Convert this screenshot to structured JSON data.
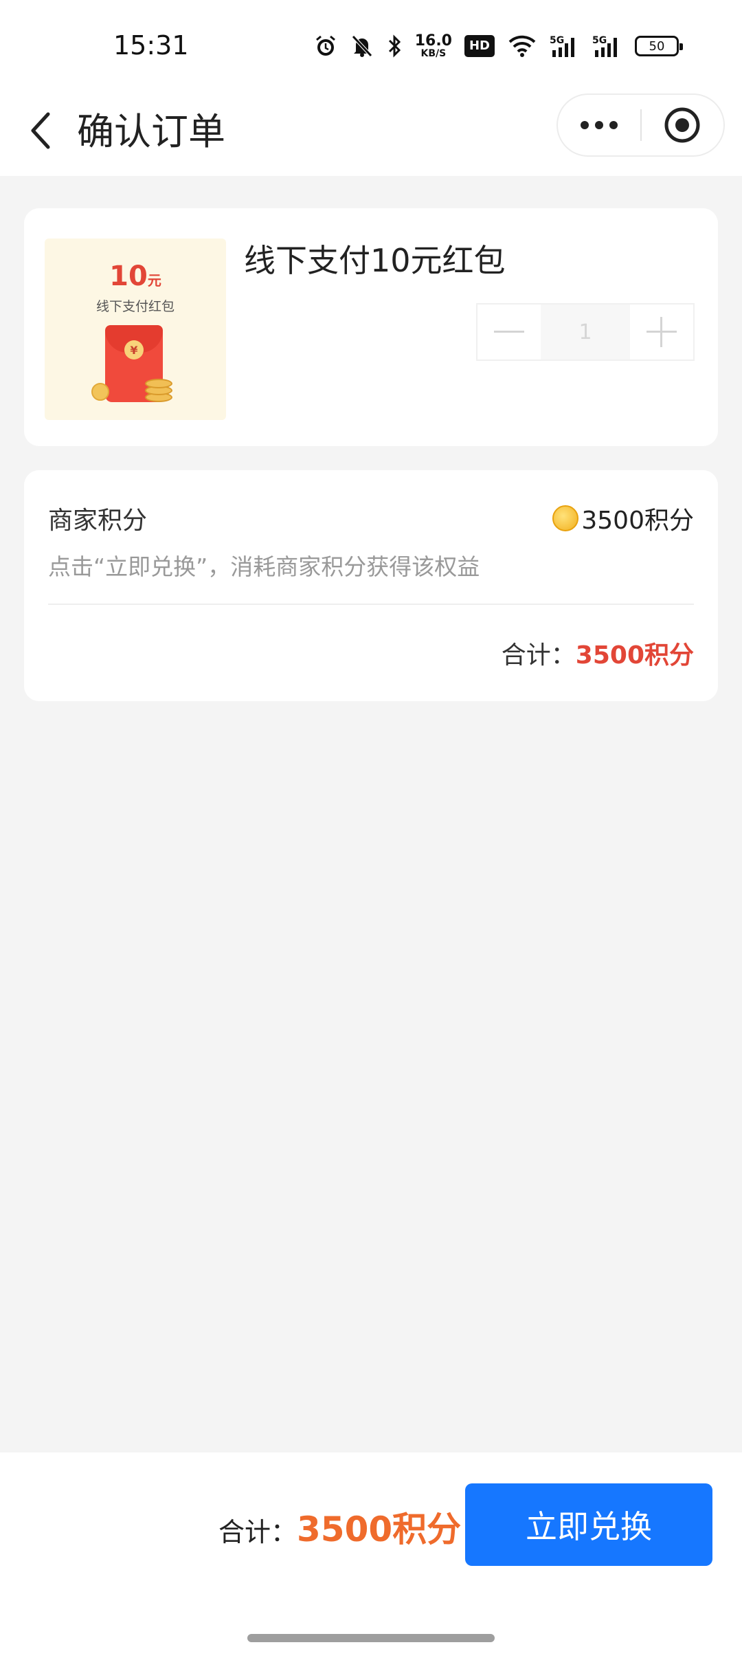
{
  "status_bar": {
    "time": "15:31",
    "speed_value": "16.0",
    "speed_unit": "KB/S",
    "hd_label": "HD",
    "network_1": "5G",
    "network_2": "5G",
    "battery": "50"
  },
  "nav": {
    "title": "确认订单"
  },
  "product": {
    "title": "线下支付10元红包",
    "thumb_amount": "10",
    "thumb_unit": "元",
    "thumb_caption": "线下支付红包",
    "seal_symbol": "¥",
    "quantity": "1"
  },
  "points": {
    "label": "商家积分",
    "value": "3500积分",
    "hint": "点击“立即兑换”，消耗商家积分获得该权益",
    "total_label": "合计：",
    "total_value": "3500积分"
  },
  "bottom": {
    "total_label": "合计：",
    "total_value": "3500积分",
    "button_label": "立即兑换"
  },
  "colors": {
    "accent_blue": "#1677ff",
    "price_red": "#e24637",
    "price_orange": "#ef6b2c",
    "page_background": "#f4f4f4"
  }
}
